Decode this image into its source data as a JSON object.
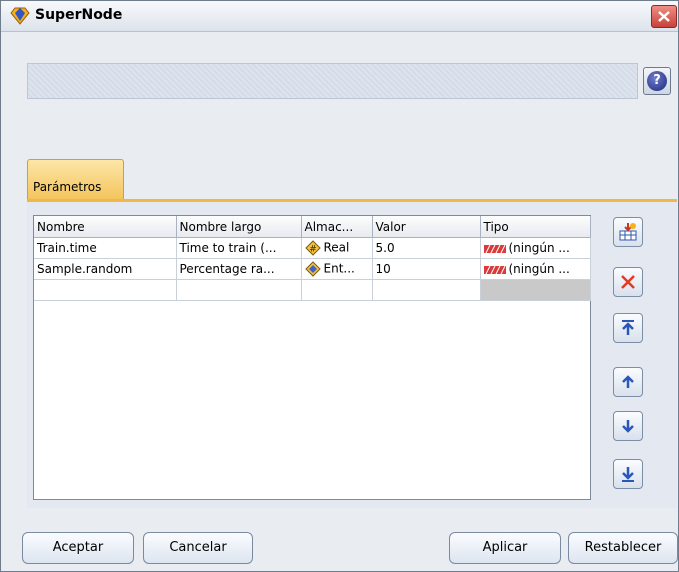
{
  "window": {
    "title": "SuperNode",
    "colors": {
      "tab": "#f4c45a",
      "close": "#c9413a",
      "help": "#1d2a7d"
    }
  },
  "toolbar": {
    "help_icon": "question-mark-icon",
    "help_label": "?"
  },
  "tabs": [
    {
      "label": "Parámetros",
      "active": true
    }
  ],
  "table": {
    "columns": [
      "Nombre",
      "Nombre largo",
      "Almac...",
      "Valor",
      "Tipo"
    ],
    "rows": [
      {
        "nombre": "Train.time",
        "nombre_largo": "Time to train (...",
        "almac": "Real",
        "almac_icon": "real-storage-icon",
        "valor": "5.0",
        "tipo": "(ningún ...",
        "tipo_icon": "range-type-icon"
      },
      {
        "nombre": "Sample.random",
        "nombre_largo": "Percentage ra...",
        "almac": "Ent...",
        "almac_icon": "integer-storage-icon",
        "valor": "10",
        "tipo": "(ningún ...",
        "tipo_icon": "range-type-icon"
      }
    ]
  },
  "side_buttons": [
    "add-parameter-icon",
    "delete-icon",
    "move-to-top-icon",
    "move-up-icon",
    "move-down-icon",
    "move-to-bottom-icon"
  ],
  "buttons": {
    "ok": "Aceptar",
    "cancel": "Cancelar",
    "apply": "Aplicar",
    "reset": "Restablecer"
  }
}
